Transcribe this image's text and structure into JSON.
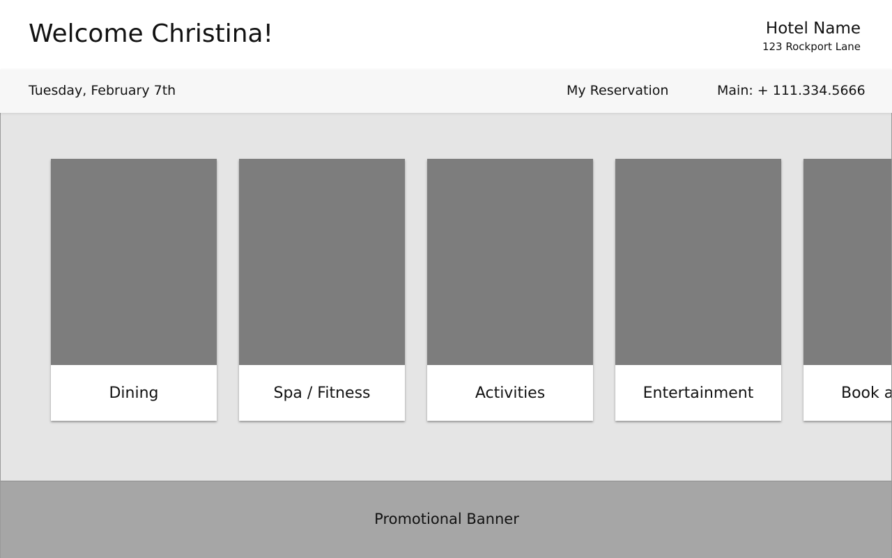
{
  "header": {
    "welcome": "Welcome Christina!",
    "hotel_name": "Hotel Name",
    "hotel_address": "123 Rockport Lane"
  },
  "infobar": {
    "date": "Tuesday, February 7th",
    "reservation_label": "My Reservation",
    "phone": "Main: + 111.334.5666"
  },
  "tiles": [
    {
      "label": "Dining"
    },
    {
      "label": "Spa / Fitness"
    },
    {
      "label": "Activities"
    },
    {
      "label": "Entertainment"
    },
    {
      "label": "Book a"
    }
  ],
  "banner": {
    "label": "Promotional Banner"
  },
  "colors": {
    "content_bg": "#e5e5e5",
    "tile_image": "#7d7d7d",
    "banner_bg": "#a6a6a6"
  }
}
